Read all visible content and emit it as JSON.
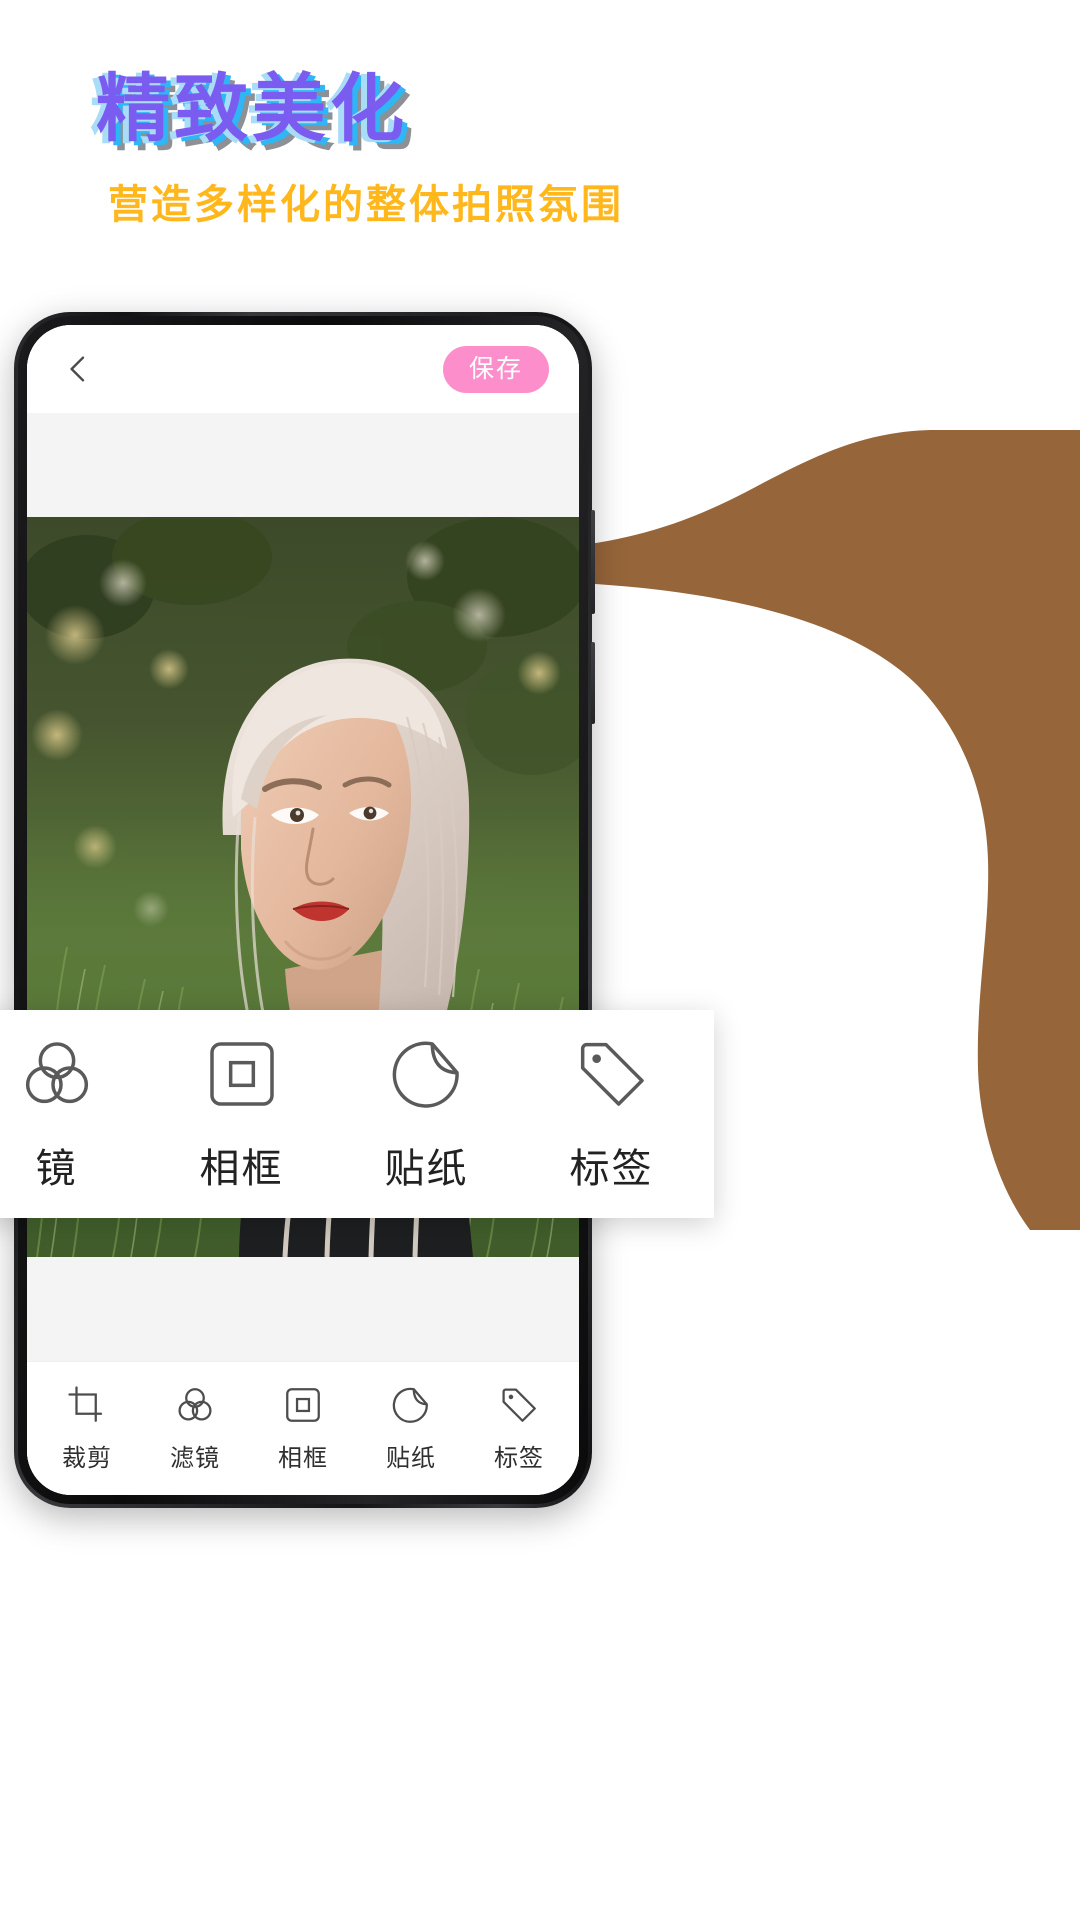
{
  "hero": {
    "title": "精致美化",
    "subtitle": "营造多样化的整体拍照氛围",
    "title_color": "#7b5cf0",
    "title_accent_cyan": "#2eb6f5",
    "title_accent_light": "#a9dcf6",
    "title_shadow": "#8d9094",
    "subtitle_color": "#ffb71c"
  },
  "decor": {
    "blob_color": "#96653a",
    "blob_name": "brown-wave-shape"
  },
  "phone": {
    "frame_color": "#1a1a1c",
    "screen_bg": "#ffffff"
  },
  "app": {
    "topbar": {
      "back_icon": "chevron-left-icon",
      "save_label": "保存",
      "save_bg": "#fc8fcb",
      "save_text_color": "#ffffff"
    },
    "canvas": {
      "bg": "#f4f4f4",
      "photo_alt": "portrait-photo"
    },
    "toolbar": {
      "items": [
        {
          "label": "裁剪",
          "icon": "crop-icon"
        },
        {
          "label": "滤镜",
          "icon": "filter-circles-icon"
        },
        {
          "label": "相框",
          "icon": "frame-icon"
        },
        {
          "label": "贴纸",
          "icon": "sticker-icon"
        },
        {
          "label": "标签",
          "icon": "tag-icon"
        }
      ]
    }
  },
  "magnified_panel": {
    "bg": "#ffffff",
    "items": [
      {
        "label": "镜",
        "icon": "filter-circles-icon"
      },
      {
        "label": "相框",
        "icon": "frame-icon"
      },
      {
        "label": "贴纸",
        "icon": "sticker-icon"
      },
      {
        "label": "标签",
        "icon": "tag-icon"
      }
    ]
  }
}
